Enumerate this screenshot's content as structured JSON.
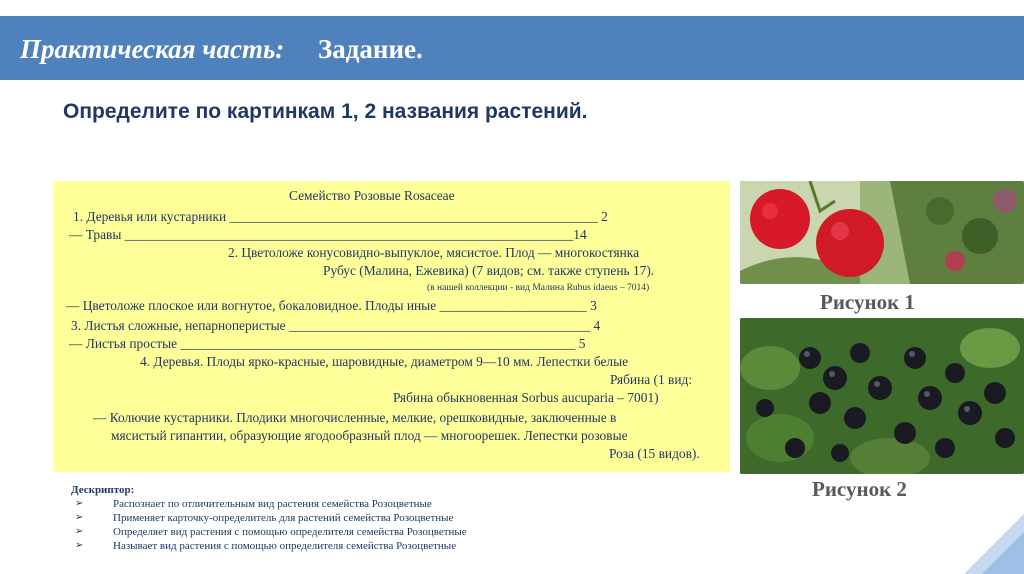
{
  "header": {
    "title_italic": "Практическая часть:",
    "title_main": "Задание."
  },
  "task": "Определите по картинкам 1, 2 названия растений.",
  "key": {
    "title": "Семейство Розовые Rosaceae",
    "lines": [
      "1.  Деревья или кустарники _______________________________________________________ 2",
      "—  Травы ___________________________________________________________________14",
      "2.  Цветоложе конусовидно-выпуклое,  мясистое. Плод — многокостянка",
      "Рубус (Малина, Ежевика) (7 видов; см. также ступень 17).",
      "(в нашей коллекции - вид Малина Rubus idaeus – 7014)",
      "—  Цветоложе плоское или вогнутое, бокаловидное. Плоды иные ______________________ 3",
      "3.  Листья сложные, непарноперистые _____________________________________________ 4",
      "—  Листья простые ___________________________________________________________ 5",
      "4.  Деревья. Плоды ярко-красные, шаровидные, диаметром 9—10 мм. Лепестки  белые",
      "Рябина (1  вид:",
      "Рябина обыкновенная Sorbus aucuparia – 7001)",
      "—  Колючие кустарники. Плодики многочисленные, мелкие, орешковидные, заключенные в",
      "мясистый гипантии, образующие ягодообразный плод — многоорешек. Лепестки розовые",
      "Роза (15 видов)."
    ]
  },
  "descriptor": {
    "title": "Дескриптор:",
    "items": [
      "Распознает по отличительным вид растения семейства Розоцветные",
      "Применяет карточку-определитель для растений семейства Розоцветные",
      "Определяет вид растения с помощью определителя семейства Розоцветные",
      "Называет вид растения с помощью определителя семейства Розоцветные"
    ]
  },
  "figures": {
    "caption1": "Рисунок 1",
    "caption2": "Рисунок 2"
  },
  "colors": {
    "header": "#4f81bd",
    "key_bg": "#ffff99",
    "text": "#1f3864"
  }
}
